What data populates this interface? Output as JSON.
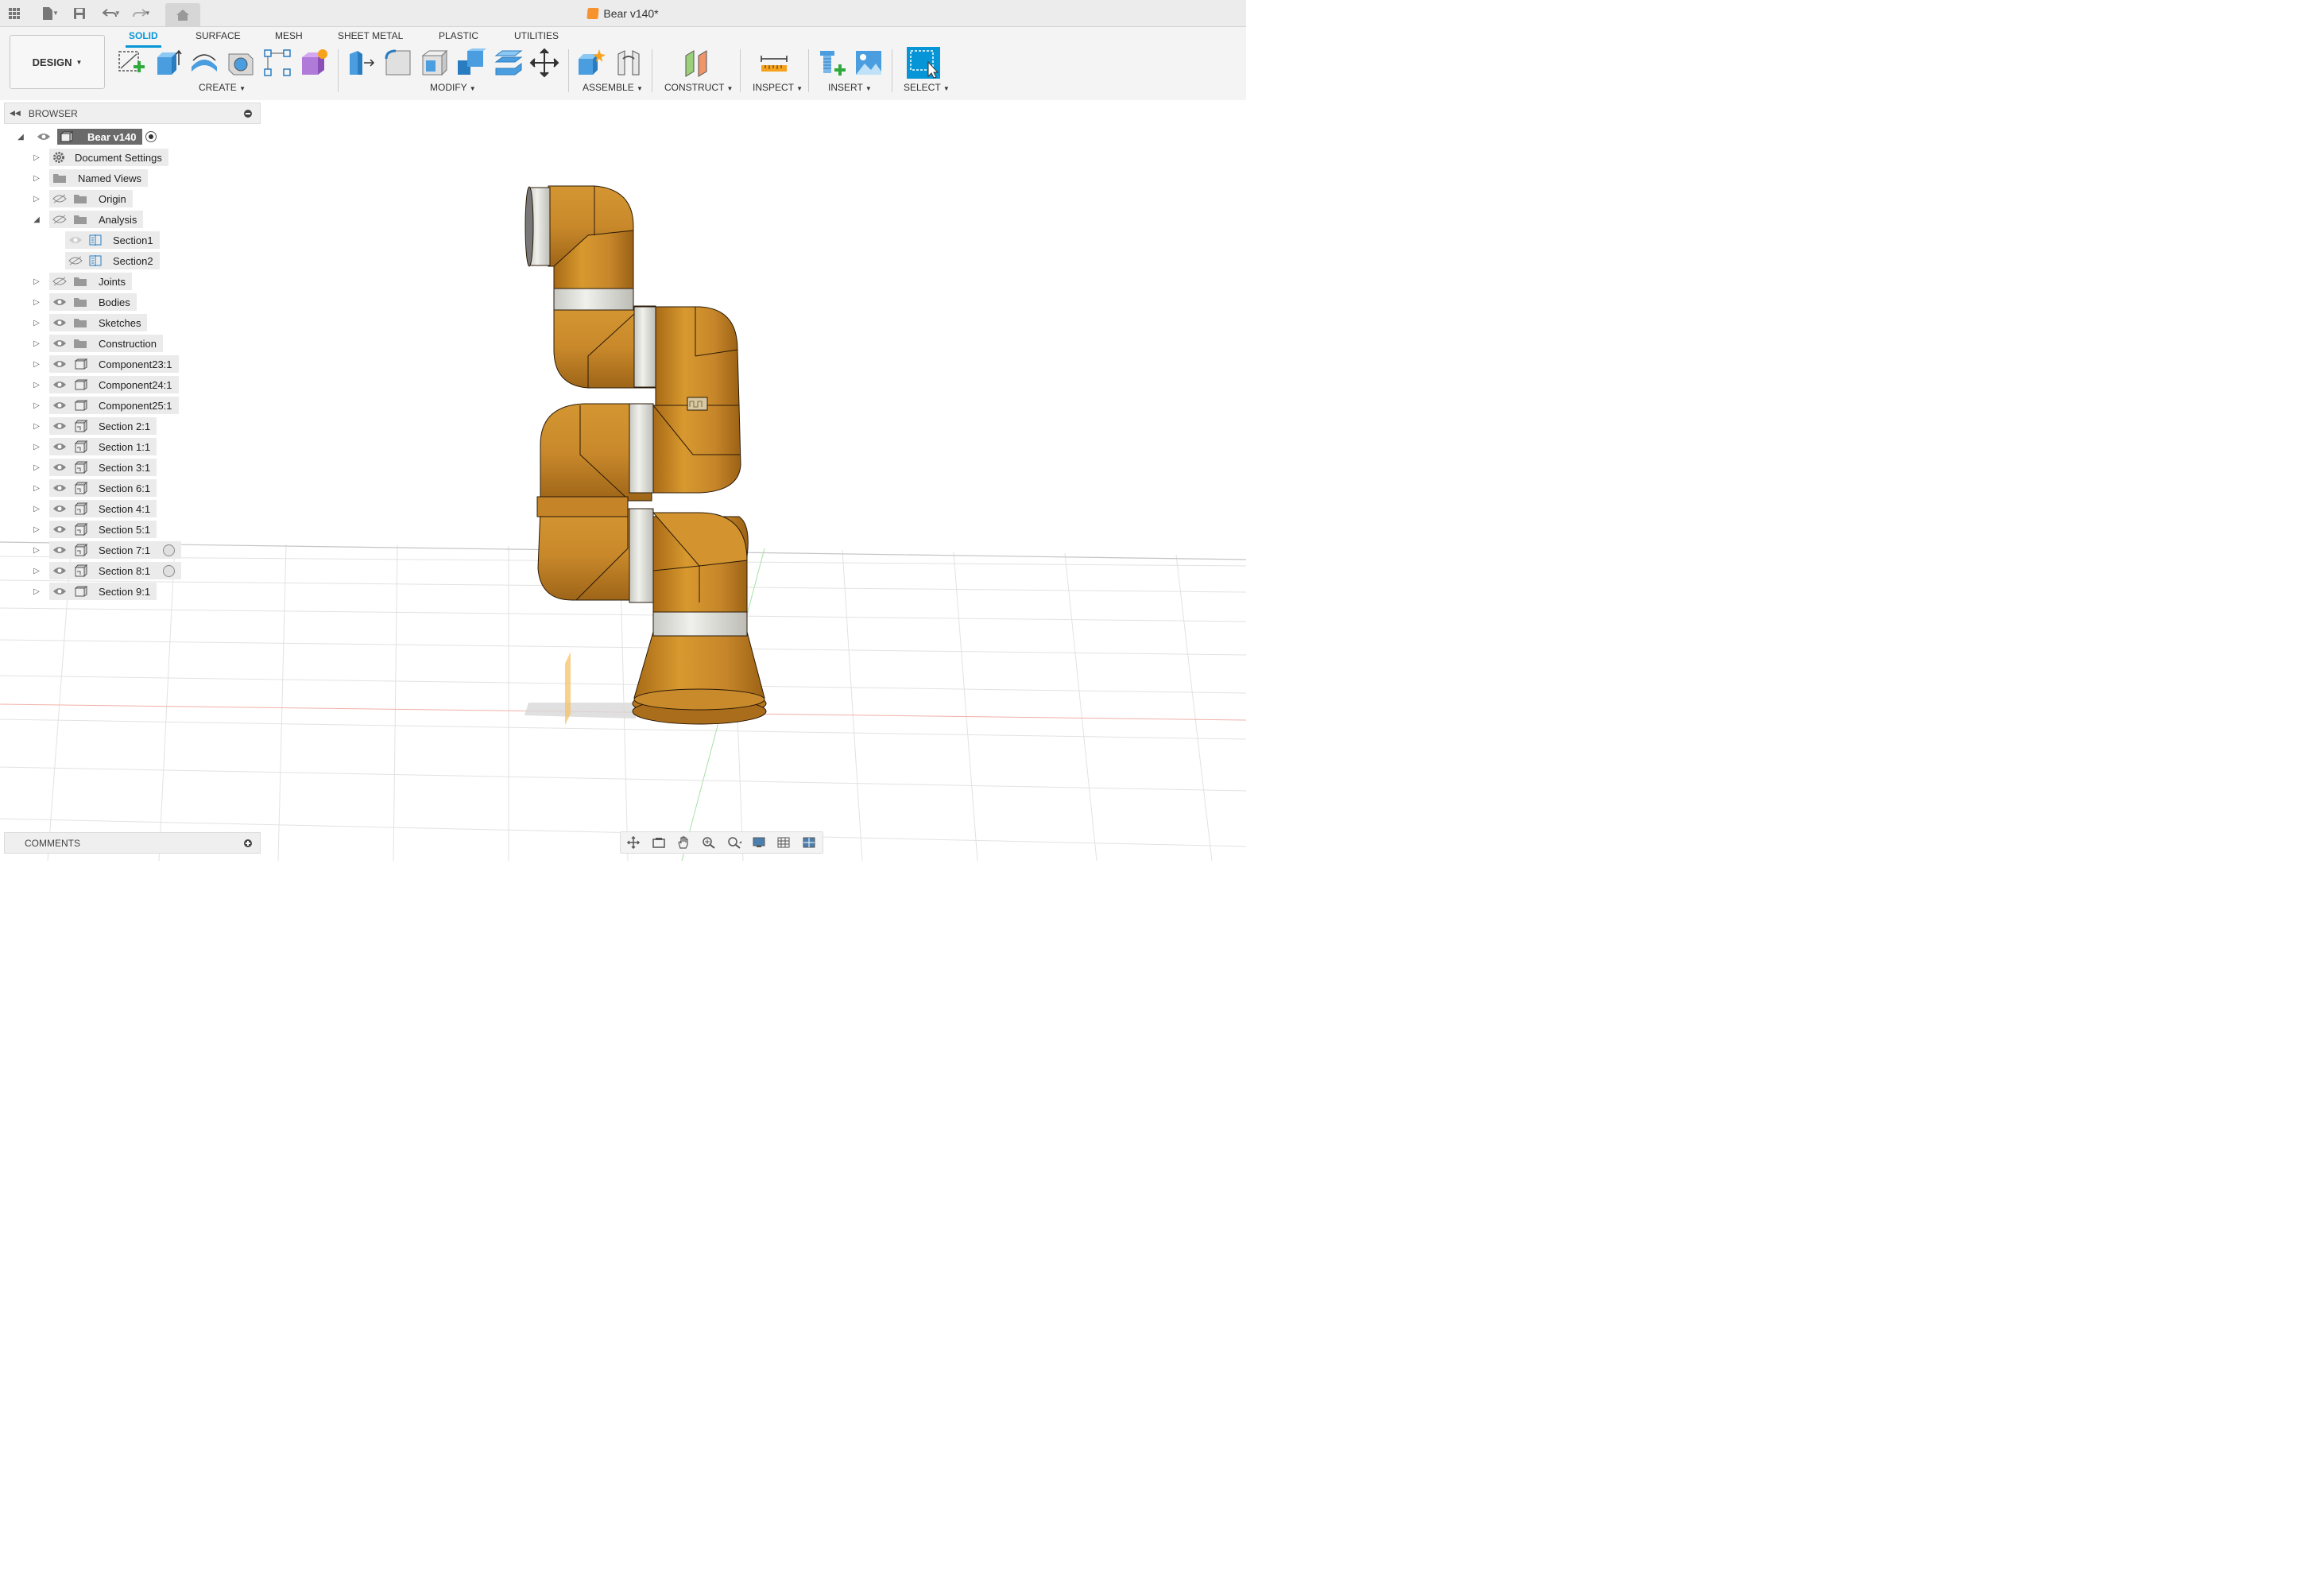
{
  "document": {
    "title": "Bear v140*"
  },
  "workspace": {
    "label": "DESIGN"
  },
  "tabs": [
    {
      "label": "SOLID",
      "active": true
    },
    {
      "label": "SURFACE"
    },
    {
      "label": "MESH"
    },
    {
      "label": "SHEET METAL"
    },
    {
      "label": "PLASTIC"
    },
    {
      "label": "UTILITIES"
    }
  ],
  "groups": {
    "create": "CREATE",
    "modify": "MODIFY",
    "assemble": "ASSEMBLE",
    "construct": "CONSTRUCT",
    "inspect": "INSPECT",
    "insert": "INSERT",
    "select": "SELECT"
  },
  "browser": {
    "header": "BROWSER",
    "root": "Bear v140",
    "items": [
      {
        "label": "Document Settings",
        "icon": "gear-icon"
      },
      {
        "label": "Named Views",
        "icon": "folder-icon"
      },
      {
        "label": "Origin",
        "icon": "folder-icon",
        "hidden": true
      },
      {
        "label": "Analysis",
        "icon": "folder-icon",
        "hidden": true,
        "expanded": true
      },
      {
        "label": "Section1",
        "icon": "section-analysis-icon",
        "child": true
      },
      {
        "label": "Section2",
        "icon": "section-analysis-icon",
        "child": true,
        "hidden": true
      },
      {
        "label": "Joints",
        "icon": "folder-icon",
        "hidden": true
      },
      {
        "label": "Bodies",
        "icon": "folder-icon"
      },
      {
        "label": "Sketches",
        "icon": "folder-icon"
      },
      {
        "label": "Construction",
        "icon": "folder-icon"
      },
      {
        "label": "Component23:1",
        "icon": "component-icon"
      },
      {
        "label": "Component24:1",
        "icon": "component-icon"
      },
      {
        "label": "Component25:1",
        "icon": "component-icon"
      },
      {
        "label": "Section 2:1",
        "icon": "linked-component-icon"
      },
      {
        "label": "Section 1:1",
        "icon": "linked-component-icon"
      },
      {
        "label": "Section 3:1",
        "icon": "linked-component-icon"
      },
      {
        "label": "Section 6:1",
        "icon": "linked-component-icon"
      },
      {
        "label": "Section 4:1",
        "icon": "linked-component-icon"
      },
      {
        "label": "Section 5:1",
        "icon": "linked-component-icon"
      },
      {
        "label": "Section 7:1",
        "icon": "linked-component-icon",
        "radio": true
      },
      {
        "label": "Section 8:1",
        "icon": "linked-component-icon",
        "radio": true
      },
      {
        "label": "Section 9:1",
        "icon": "component-icon"
      }
    ]
  },
  "comments": {
    "label": "COMMENTS"
  },
  "colors": {
    "accent": "#0696d7",
    "robot_orange": "#c98a2c",
    "robot_band": "#e6e6e2"
  }
}
